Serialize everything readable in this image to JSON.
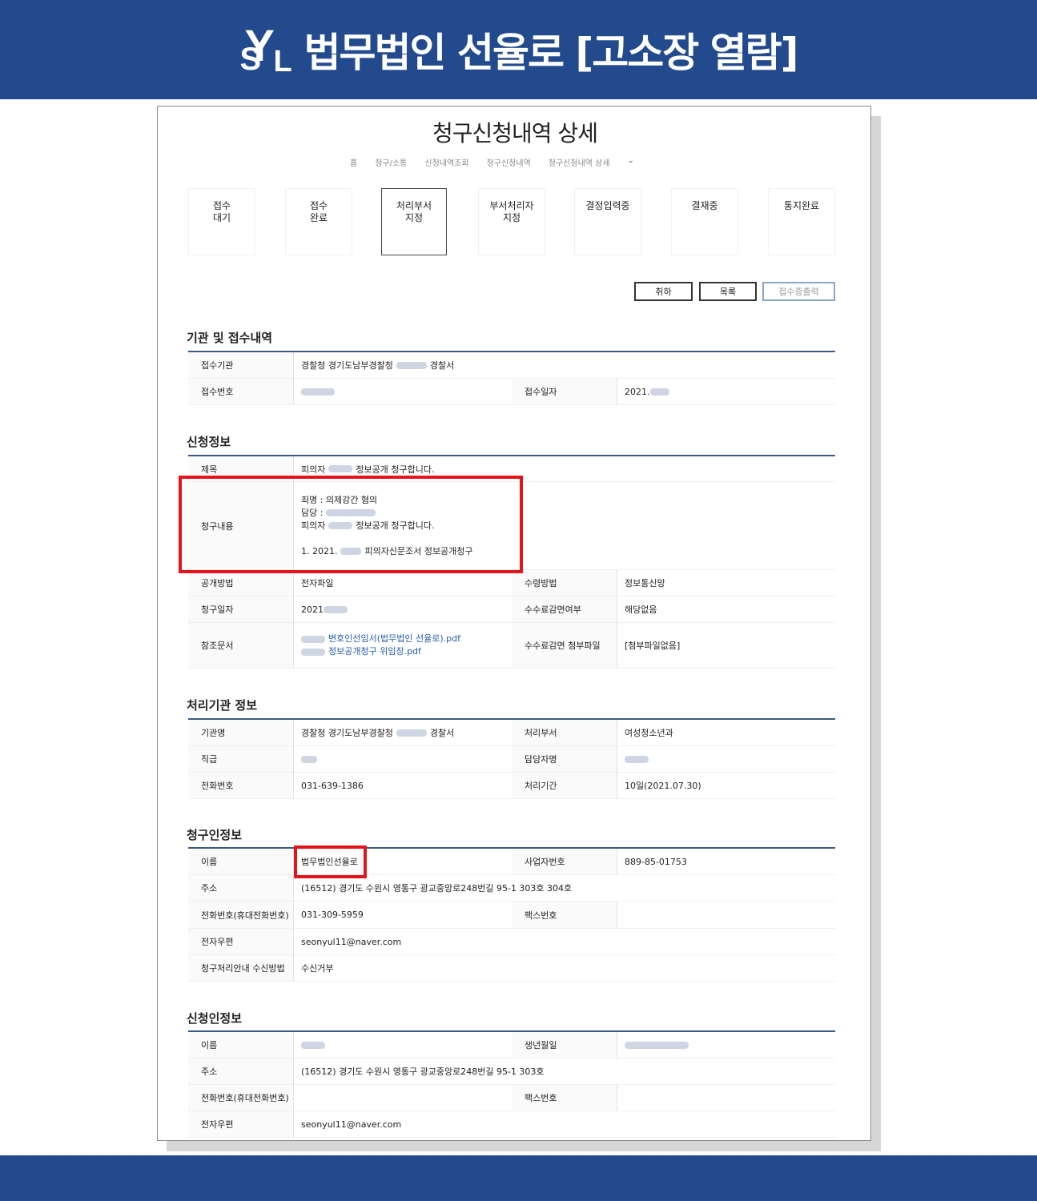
{
  "banner": {
    "logo_y": "Y",
    "logo_s": "S",
    "logo_l": "L",
    "title": "법무법인 선율로 [고소장 열람]"
  },
  "page": {
    "title": "청구신청내역 상세",
    "breadcrumb": [
      "홈",
      "청구/소통",
      "신청내역조회",
      "청구신청내역",
      "청구신청내역 상세"
    ],
    "breadcrumb_chevron": "⌄"
  },
  "steps": [
    {
      "line1": "접수",
      "line2": "대기"
    },
    {
      "line1": "접수",
      "line2": "완료"
    },
    {
      "line1": "처리부서",
      "line2": "지정"
    },
    {
      "line1": "부서처리자",
      "line2": "지정"
    },
    {
      "line1": "결정입력중",
      "line2": ""
    },
    {
      "line1": "결재중",
      "line2": ""
    },
    {
      "line1": "통지완료",
      "line2": ""
    }
  ],
  "active_step": 2,
  "buttons": {
    "cancel": "취하",
    "list": "목록",
    "receipt": "접수증출력"
  },
  "institution": {
    "title": "기관 및 접수내역",
    "received_org_label": "접수기관",
    "received_org_prefix": "경찰청 경기도남부경찰청",
    "received_org_suffix": "경찰서",
    "received_no_label": "접수번호",
    "received_date_label": "접수일자",
    "received_date_prefix": "2021."
  },
  "request": {
    "title": "신청정보",
    "subject_label": "제목",
    "subject_prefix": "피의자",
    "subject_suffix": "정보공개 청구합니다.",
    "content_label": "청구내용",
    "content_line1": "죄명 : 의제강간 혐의",
    "content_line2": "담당 :",
    "content_line3_prefix": "피의자",
    "content_line3_suffix": "정보공개 청구합니다.",
    "content_line4_prefix": "1. 2021.",
    "content_line4_suffix": "피의자신문조서 정보공개청구",
    "disclosure_label": "공개방법",
    "disclosure_value": "전자파일",
    "receive_label": "수령방법",
    "receive_value": "정보통신망",
    "date_label": "청구일자",
    "date_prefix": "2021",
    "fee_label": "수수료감면여부",
    "fee_value": "해당없음",
    "ref_label": "참조문서",
    "ref_file1": "변호인선임서(법무법인 선율로).pdf",
    "ref_file2": "정보공개청구 위임장.pdf",
    "fee_attach_label": "수수료감면 첨부파일",
    "fee_attach_value": "[첨부파일없음]"
  },
  "handling": {
    "title": "처리기관 정보",
    "org_label": "기관명",
    "org_prefix": "경찰청 경기도남부경찰청",
    "org_suffix": "경찰서",
    "dept_label": "처리부서",
    "dept_value": "여성청소년과",
    "rank_label": "직급",
    "officer_label": "담당자명",
    "phone_label": "전화번호",
    "phone_value": "031-639-1386",
    "period_label": "처리기간",
    "period_value": "10일(2021.07.30)"
  },
  "claimant": {
    "title": "청구인정보",
    "name_label": "이름",
    "name_value": "법무법인선율로",
    "biz_label": "사업자번호",
    "biz_value": "889-85-01753",
    "addr_label": "주소",
    "addr_value": "(16512) 경기도 수원시 영통구 광교중앙로248번길 95-1 303호 304호",
    "phone_label": "전화번호(휴대전화번호)",
    "phone_value": "031-309-5959",
    "fax_label": "팩스번호",
    "email_label": "전자우편",
    "email_value": "seonyul11@naver.com",
    "notice_label": "청구처리안내 수신방법",
    "notice_value": "수신거부"
  },
  "applicant": {
    "title": "신청인정보",
    "name_label": "이름",
    "birth_label": "생년월일",
    "addr_label": "주소",
    "addr_value": "(16512) 경기도 수원시 영통구 광교중앙로248번길 95-1 303호",
    "phone_label": "전화번호(휴대전화번호)",
    "fax_label": "팩스번호",
    "email_label": "전자우편",
    "email_value": "seonyul11@naver.com"
  },
  "colors": {
    "banner": "#224a8c",
    "highlight": "#e4141b",
    "link": "#2a5db0",
    "section_line": "#3a5a80"
  }
}
